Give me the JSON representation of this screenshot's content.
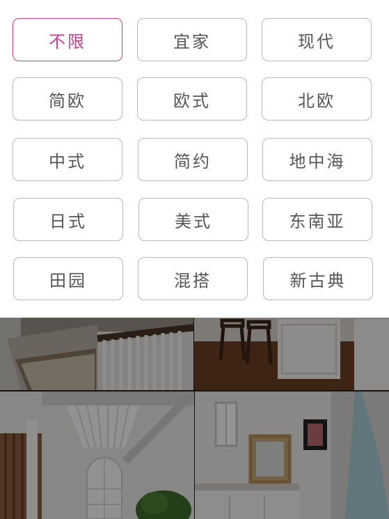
{
  "filter": {
    "selected_index": 0,
    "accent_color": "#c2418f",
    "options": [
      {
        "label": "不限"
      },
      {
        "label": "宜家"
      },
      {
        "label": "现代"
      },
      {
        "label": "简欧"
      },
      {
        "label": "欧式"
      },
      {
        "label": "北欧"
      },
      {
        "label": "中式"
      },
      {
        "label": "简约"
      },
      {
        "label": "地中海"
      },
      {
        "label": "日式"
      },
      {
        "label": "美式"
      },
      {
        "label": "东南亚"
      },
      {
        "label": "田园"
      },
      {
        "label": "混搭"
      },
      {
        "label": "新古典"
      }
    ]
  },
  "background_photos": [
    {
      "name": "staircase-photo"
    },
    {
      "name": "kitchen-photo"
    },
    {
      "name": "hallway-photo"
    },
    {
      "name": "bathroom-photo"
    }
  ]
}
